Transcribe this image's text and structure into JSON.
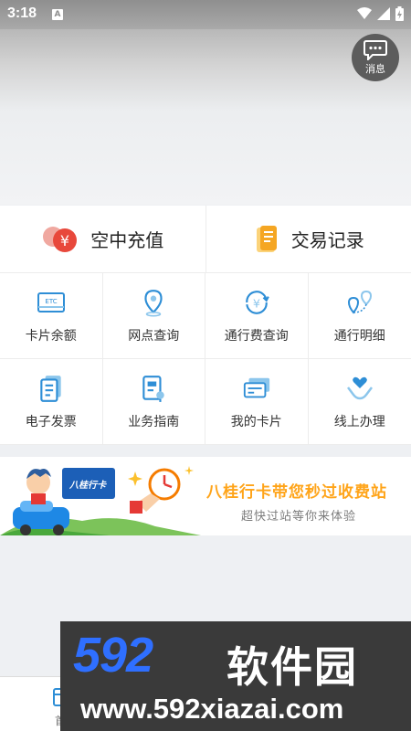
{
  "status_bar": {
    "time": "3:18",
    "notification_badge": "A"
  },
  "header": {
    "message_button_label": "消息"
  },
  "quick_actions": [
    {
      "label": "空中充值",
      "icon": "coins-icon"
    },
    {
      "label": "交易记录",
      "icon": "scroll-icon"
    }
  ],
  "grid_items": [
    {
      "label": "卡片余额",
      "icon": "etc-card-icon",
      "icon_text": "ETC"
    },
    {
      "label": "网点查询",
      "icon": "location-pin-icon"
    },
    {
      "label": "通行费查询",
      "icon": "yen-refresh-icon"
    },
    {
      "label": "通行明细",
      "icon": "route-icon"
    },
    {
      "label": "电子发票",
      "icon": "invoice-icon"
    },
    {
      "label": "业务指南",
      "icon": "guide-icon"
    },
    {
      "label": "我的卡片",
      "icon": "cards-icon"
    },
    {
      "label": "线上办理",
      "icon": "hand-heart-icon"
    }
  ],
  "banner": {
    "title": "八桂行卡带您秒过收费站",
    "subtitle": "超快过站等你来体验",
    "card_text": "八桂行卡"
  },
  "bottom_nav": {
    "home_label_partial": "首"
  },
  "watermark": {
    "logo": "592",
    "brand": "软件园",
    "url": "www.592xiazai.com"
  },
  "colors": {
    "accent_blue": "#2e8ed6",
    "orange": "#f5a623",
    "red": "#e8483b",
    "watermark_blue": "#2f6fff"
  }
}
